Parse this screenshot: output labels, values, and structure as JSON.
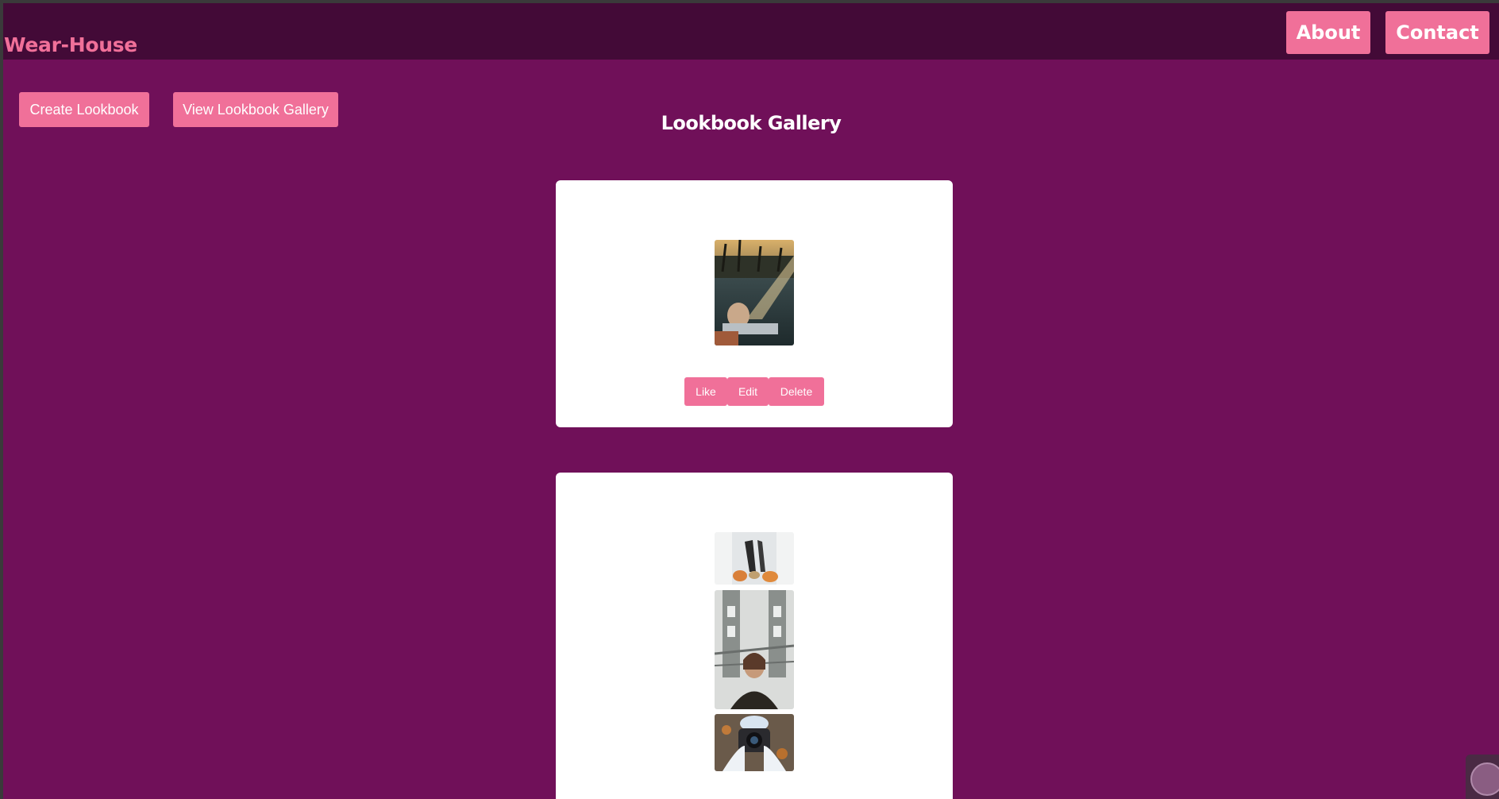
{
  "header": {
    "brand": "Wear-House",
    "nav": {
      "about": "About",
      "contact": "Contact"
    }
  },
  "actions": {
    "create": "Create Lookbook",
    "view": "View Lookbook Gallery"
  },
  "page_title": "Lookbook Gallery",
  "cards": [
    {
      "photos": [
        "photo-woman-by-pool-at-sunset"
      ],
      "buttons": {
        "like": "Like",
        "edit": "Edit",
        "delete": "Delete"
      }
    },
    {
      "photos": [
        "photo-shoes-and-pumpkins",
        "photo-woman-under-bridge",
        "photo-hands-holding-camera"
      ]
    }
  ],
  "colors": {
    "page_bg": "#701059",
    "header_bg": "#430a37",
    "accent": "#f07099",
    "card_bg": "#ffffff"
  }
}
